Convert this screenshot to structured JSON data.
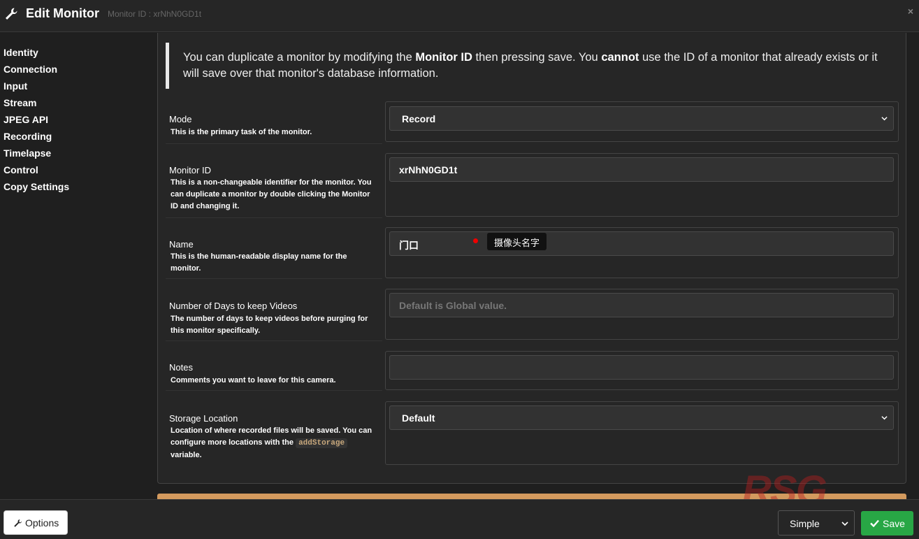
{
  "header": {
    "title": "Edit Monitor",
    "subtitle": "Monitor ID : xrNhN0GD1t",
    "close_glyph": "×",
    "icon": "wrench-icon"
  },
  "sidebar": {
    "items": [
      {
        "label": "Identity"
      },
      {
        "label": "Connection"
      },
      {
        "label": "Input"
      },
      {
        "label": "Stream"
      },
      {
        "label": "JPEG API"
      },
      {
        "label": "Recording"
      },
      {
        "label": "Timelapse"
      },
      {
        "label": "Control"
      },
      {
        "label": "Copy Settings"
      }
    ]
  },
  "notice": {
    "part1": "You can duplicate a monitor by modifying the ",
    "bold1": "Monitor ID",
    "part2": " then pressing save. You ",
    "bold2": "cannot",
    "part3": " use the ID of a monitor that already exists or it will save over that monitor's database information."
  },
  "fields": {
    "mode": {
      "label": "Mode",
      "desc": "This is the primary task of the monitor.",
      "value": "Record"
    },
    "monitor_id": {
      "label": "Monitor ID",
      "desc": "This is a non-changeable identifier for the monitor. You can duplicate a monitor by double clicking the Monitor ID and changing it.",
      "value": "xrNhN0GD1t"
    },
    "name": {
      "label": "Name",
      "desc": "This is the human-readable display name for the monitor.",
      "value": "门口"
    },
    "days": {
      "label": "Number of Days to keep Videos",
      "desc": "The number of days to keep videos before purging for this monitor specifically.",
      "placeholder": "Default is Global value."
    },
    "notes": {
      "label": "Notes",
      "desc": "Comments you want to leave for this camera.",
      "value": ""
    },
    "storage": {
      "label": "Storage Location",
      "desc_part1": "Location of where recorded files will be saved. You can configure more locations with the ",
      "desc_code": "addStorage",
      "desc_part2": " variable.",
      "value": "Default"
    }
  },
  "tooltip": {
    "text": "摄像头名字"
  },
  "footer": {
    "options_label": "Options",
    "view_mode": "Simple",
    "save_label": "Save"
  },
  "watermark": {
    "text": "RSG"
  },
  "colors": {
    "accent_save": "#28a745",
    "orange_bar": "#d39a5e",
    "tooltip_dot": "#e00000"
  }
}
